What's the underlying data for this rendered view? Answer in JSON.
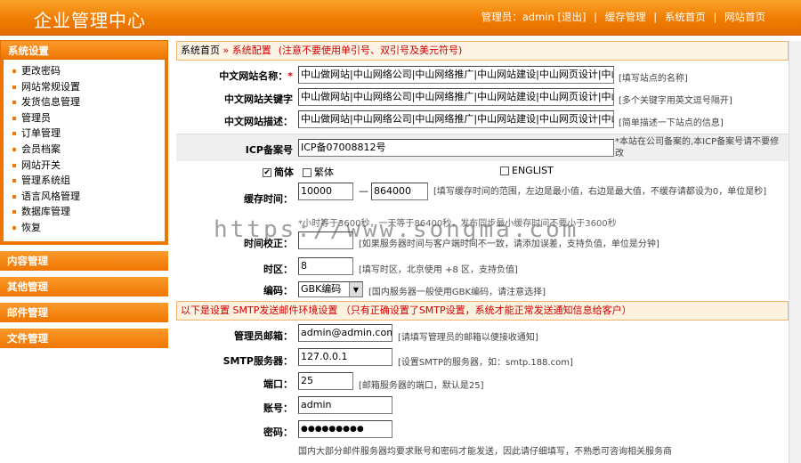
{
  "header": {
    "brand": "企业管理中心",
    "user_prefix": "管理员：",
    "user": "admin",
    "logout": "[退出]",
    "cache": "缓存管理",
    "sys_home": "系统首页",
    "site_home": "网站首页",
    "sep": "|"
  },
  "sidebar": {
    "title": "系统设置",
    "items": [
      {
        "label": "更改密码"
      },
      {
        "label": "网站常规设置"
      },
      {
        "label": "发货信息管理"
      },
      {
        "label": "管理员"
      },
      {
        "label": "订单管理"
      },
      {
        "label": "会员档案"
      },
      {
        "label": "网站开关"
      },
      {
        "label": "管理系统组"
      },
      {
        "label": "语言风格管理"
      },
      {
        "label": "数据库管理"
      },
      {
        "label": "恢复"
      }
    ],
    "groups": [
      "内容管理",
      "其他管理",
      "邮件管理",
      "文件管理"
    ]
  },
  "breadcrumb": {
    "home": "系统首页",
    "arrow": " » ",
    "current": "系统配置",
    "note": "(注意不要使用单引号、双引号及美元符号)"
  },
  "form": {
    "cn_name": {
      "label": "中文网站名称：",
      "req": "*",
      "value": "中山做网站|中山网络公司|中山网络推广|中山网站建设|中山网页设计|中山网",
      "hint": "[填写站点的名称]"
    },
    "cn_keywords": {
      "label": "中文网站关键字",
      "value": "中山做网站|中山网络公司|中山网络推广|中山网站建设|中山网页设计|中山网",
      "hint": "[多个关键字用英文逗号隔开]"
    },
    "cn_desc": {
      "label": "中文网站描述：",
      "value": "中山做网站|中山网络公司|中山网络推广|中山网站建设|中山网页设计|中山网",
      "hint": "[简单描述一下站点的信息]"
    },
    "icp": {
      "label": "ICP备案号",
      "value": "ICP备07008812号",
      "hint": "*本站在公司备案的,本ICP备案号请不要修改"
    },
    "lang": {
      "simp": "简体",
      "trad": "繁体",
      "eng": "ENGLIST",
      "simp_mark": "✔"
    },
    "cache": {
      "label": "缓存时间：",
      "min": "10000",
      "dash": "—",
      "max": "864000",
      "hint": "[填写缓存时间的范围，左边是最小值，右边是最大值，不缓存请都设为0，单位是秒]",
      "hint2": "*小时等于3600秒，一天等于86400秒，发布同步最小缓存时间不要小于3600秒"
    },
    "time": {
      "label": "时间校正：",
      "hint": "[如果服务器时间与客户端时间不一致，请添加误差，支持负值，单位是分钟]"
    },
    "tz": {
      "label": "时区：",
      "value": "8",
      "hint": "[填写时区，北京使用 +8 区，支持负值]"
    },
    "enc": {
      "label": "编码：",
      "value": "GBK编码",
      "hint": "[国内服务器一般使用GBK编码，请注意选择]"
    },
    "smtp_head": "以下是设置 SMTP发送邮件环境设置  （只有正确设置了SMTP设置，系统才能正常发送通知信息给客户）",
    "admin_mail": {
      "label": "管理员邮箱：",
      "value": "admin@admin.com",
      "hint": "[请填写管理员的邮箱以便接收通知]"
    },
    "smtp": {
      "label": "SMTP服务器：",
      "value": "127.0.0.1",
      "hint": "[设置SMTP的服务器，如：smtp.188.com]"
    },
    "port": {
      "label": "端口：",
      "value": "25",
      "hint": "[邮箱服务器的端口，默认是25]"
    },
    "account": {
      "label": "账号：",
      "value": "admin"
    },
    "password": {
      "label": "密码：",
      "value": "●●●●●●●●●"
    },
    "footer_note": "国内大部分邮件服务器均要求账号和密码才能发送，因此请仔细填写，不熟悉可咨询相关服务商"
  },
  "watermark": "https://www.songma.com"
}
